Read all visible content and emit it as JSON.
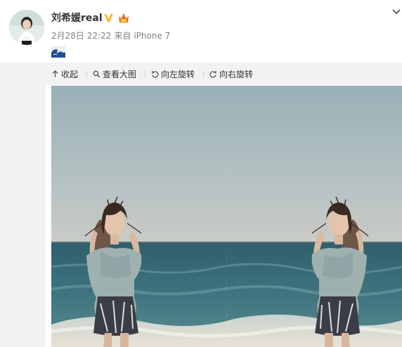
{
  "post": {
    "username": "刘希媛real",
    "verified_icon": "verified-v-icon",
    "vip_icon": "vip-crown-icon",
    "date": "2月28日 22:22",
    "source_prefix": "来自",
    "source_device": "iPhone 7",
    "emoji_icon": "great-wave-emoji",
    "menu_icon": "chevron-down-icon"
  },
  "toolbar": {
    "collapse_label": "收起",
    "view_large_label": "查看大图",
    "rotate_left_label": "向左旋转",
    "rotate_right_label": "向右旋转"
  },
  "colors": {
    "username": "#333333",
    "meta": "#808080",
    "toolbar_bg": "#f2f2f5",
    "verified": "#ffb21e",
    "sky": "#a9bcc0",
    "sea": "#3c6d77"
  }
}
